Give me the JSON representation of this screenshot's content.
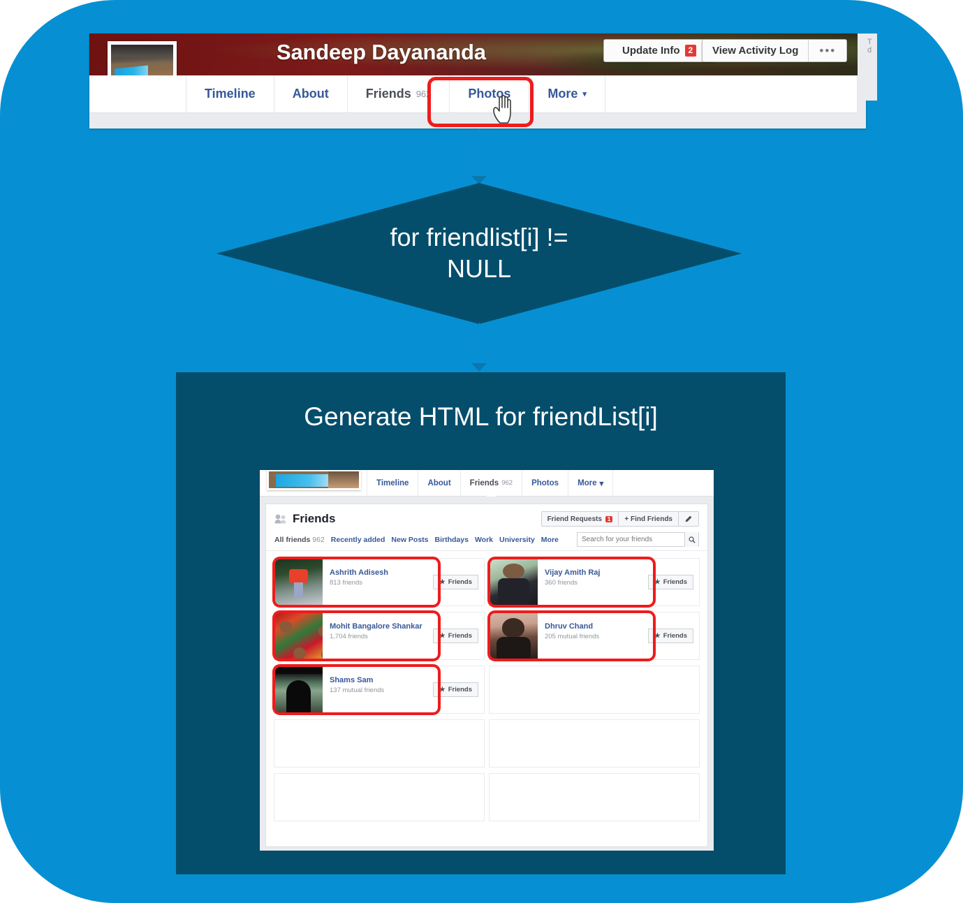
{
  "colors": {
    "canvas_blue": "#0690d3",
    "dark_navy": "#044e6c",
    "highlight_red": "#ee1c1c",
    "fb_link_blue": "#365899",
    "badge_red": "#e53935"
  },
  "flow": {
    "decision_text": "for friendlist[i] !=\nNULL",
    "process_title": "Generate HTML for friendList[i]"
  },
  "profile_header": {
    "name": "Sandeep Dayananda",
    "update_info_label": "Update Info",
    "update_info_count": "2",
    "view_activity_log_label": "View Activity Log",
    "more_dots": "•••",
    "sliver_text": "T\nd",
    "tabs": [
      {
        "label": "Timeline",
        "count": ""
      },
      {
        "label": "About",
        "count": ""
      },
      {
        "label": "Friends",
        "count": "962"
      },
      {
        "label": "Photos",
        "count": ""
      },
      {
        "label": "More",
        "count": "",
        "caret": "▾"
      }
    ]
  },
  "inner_screenshot": {
    "tabs": [
      {
        "label": "Timeline",
        "count": ""
      },
      {
        "label": "About",
        "count": ""
      },
      {
        "label": "Friends",
        "count": "962"
      },
      {
        "label": "Photos",
        "count": ""
      },
      {
        "label": "More",
        "count": "",
        "caret": "▾"
      }
    ],
    "panel": {
      "title": "Friends",
      "friend_requests_label": "Friend Requests",
      "friend_requests_count": "1",
      "find_friends_label": "+ Find Friends",
      "edit_icon": "pencil-icon",
      "filters": [
        {
          "label": "All friends",
          "count": "962",
          "active": true
        },
        {
          "label": "Recently added",
          "count": ""
        },
        {
          "label": "New Posts",
          "count": ""
        },
        {
          "label": "Birthdays",
          "count": ""
        },
        {
          "label": "Work",
          "count": ""
        },
        {
          "label": "University",
          "count": ""
        },
        {
          "label": "More",
          "count": ""
        }
      ],
      "search_placeholder": "Search for your friends",
      "search_value": ""
    },
    "friends": [
      {
        "name": "Ashrith Adisesh",
        "meta": "813 friends",
        "action": "Friends",
        "highlighted": true,
        "avatar_class": "av1"
      },
      {
        "name": "Vijay Amith Raj",
        "meta": "360 friends",
        "action": "Friends",
        "highlighted": true,
        "avatar_class": "av2"
      },
      {
        "name": "Mohit Bangalore Shankar",
        "meta": "1,704 friends",
        "action": "Friends",
        "highlighted": true,
        "avatar_class": "av3"
      },
      {
        "name": "Dhruv Chand",
        "meta": "205 mutual friends",
        "action": "Friends",
        "highlighted": true,
        "avatar_class": "av4"
      },
      {
        "name": "Shams Sam",
        "meta": "137 mutual friends",
        "action": "Friends",
        "highlighted": true,
        "avatar_class": "av5"
      }
    ]
  }
}
